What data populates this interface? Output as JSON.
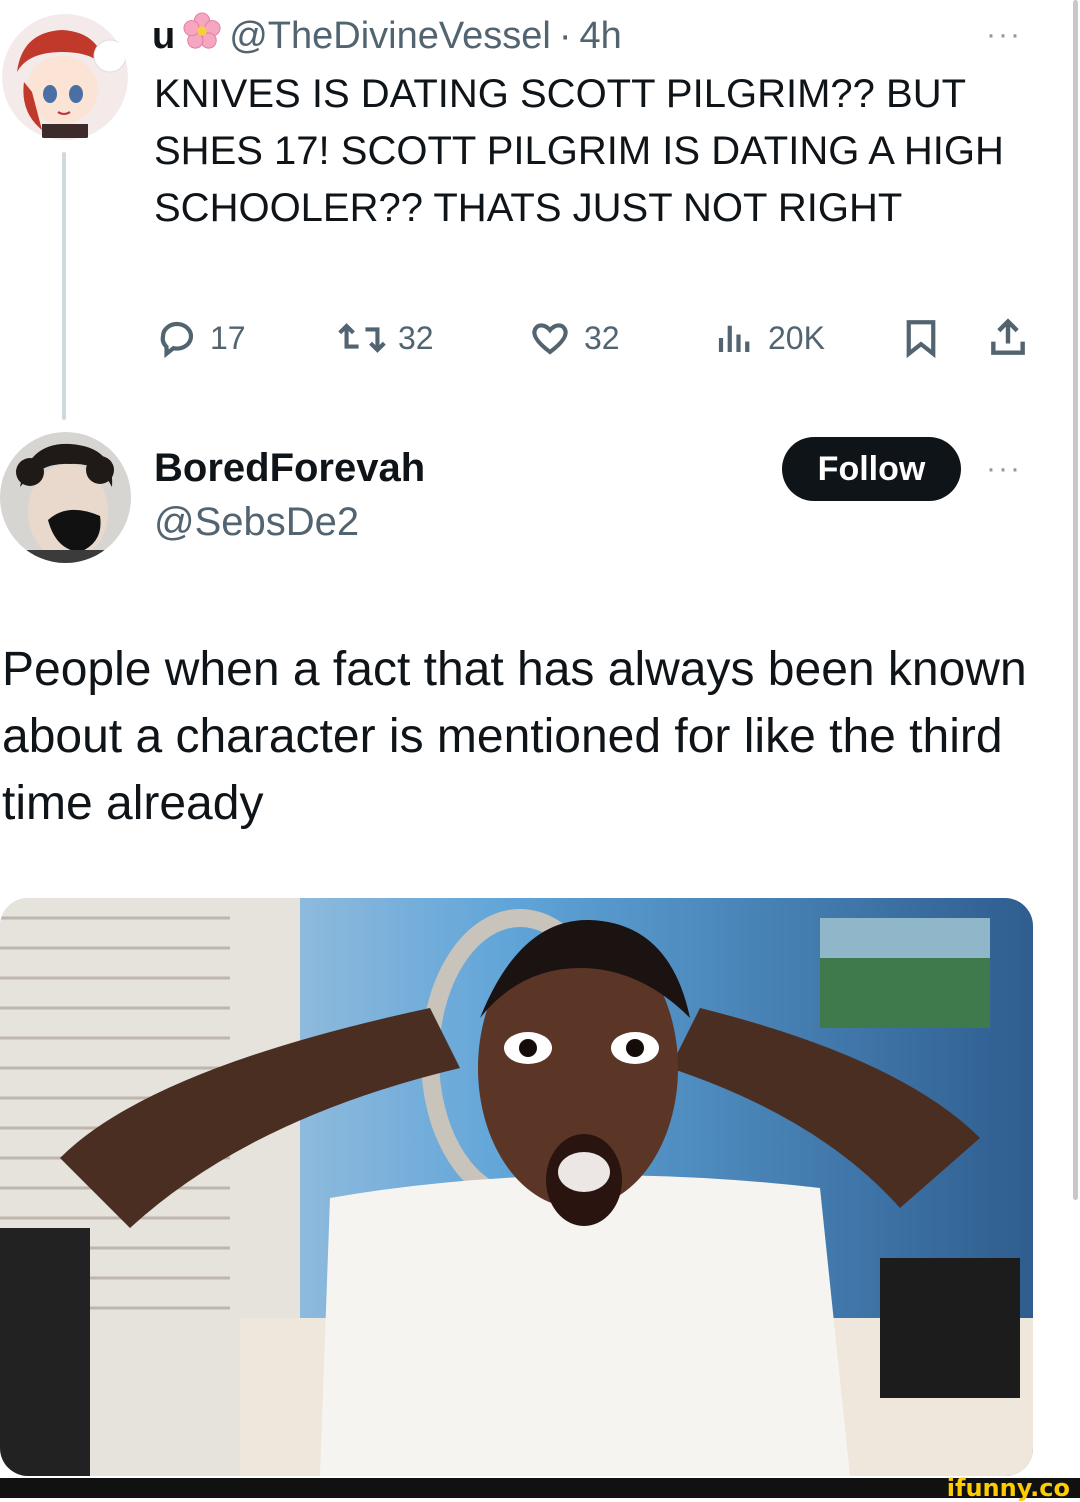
{
  "tweet1": {
    "display_name": "u",
    "handle": "@TheDivineVessel",
    "separator": "·",
    "time": "4h",
    "more": "···",
    "text": "KNIVES IS DATING SCOTT PILGRIM?? BUT SHES 17! SCOTT PILGRIM IS DATING A HIGH SCHOOLER?? THATS JUST NOT RIGHT",
    "replies": "17",
    "reposts": "32",
    "likes": "32",
    "views": "20K"
  },
  "tweet2": {
    "display_name": "BoredForevah",
    "handle": "@SebsDe2",
    "follow_label": "Follow",
    "more": "···",
    "text": "People when a fact that has always been known about a character is mentioned for like the third time already"
  },
  "watermark": "ifunny.co",
  "icons": {
    "reply": "reply-icon",
    "repost": "repost-icon",
    "like": "heart-icon",
    "views": "views-icon",
    "bookmark": "bookmark-icon",
    "share": "share-icon",
    "emoji": "cherry-blossom-icon"
  }
}
